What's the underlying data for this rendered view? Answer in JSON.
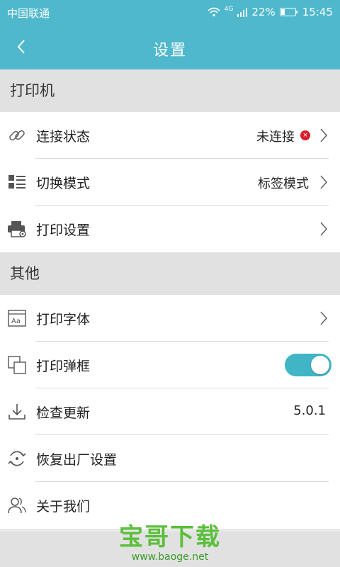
{
  "status_bar": {
    "carrier": "中国联通",
    "network": "4G",
    "battery": "22%",
    "time": "15:45"
  },
  "header": {
    "title": "设置"
  },
  "sections": [
    {
      "title": "打印机",
      "items": [
        {
          "label": "连接状态",
          "value": "未连接",
          "icon": "link-icon",
          "status_badge": "×"
        },
        {
          "label": "切换模式",
          "value": "标签模式",
          "icon": "list-grid-icon"
        },
        {
          "label": "打印设置",
          "value": "",
          "icon": "printer-icon"
        }
      ]
    },
    {
      "title": "其他",
      "items": [
        {
          "label": "打印字体",
          "value": "",
          "icon": "font-icon"
        },
        {
          "label": "打印弹框",
          "value": "",
          "icon": "dialog-icon",
          "toggle": true
        },
        {
          "label": "检查更新",
          "value": "5.0.1",
          "icon": "download-icon"
        },
        {
          "label": "恢复出厂设置",
          "value": "",
          "icon": "restore-icon"
        },
        {
          "label": "关于我们",
          "value": "",
          "icon": "user-icon"
        }
      ]
    }
  ],
  "watermark": {
    "brand": "宝哥下载",
    "url": "www.baoge.net"
  },
  "colors": {
    "accent": "#4fb8cc",
    "toggle_on": "#3fb5c6",
    "error": "#d81e2a"
  }
}
